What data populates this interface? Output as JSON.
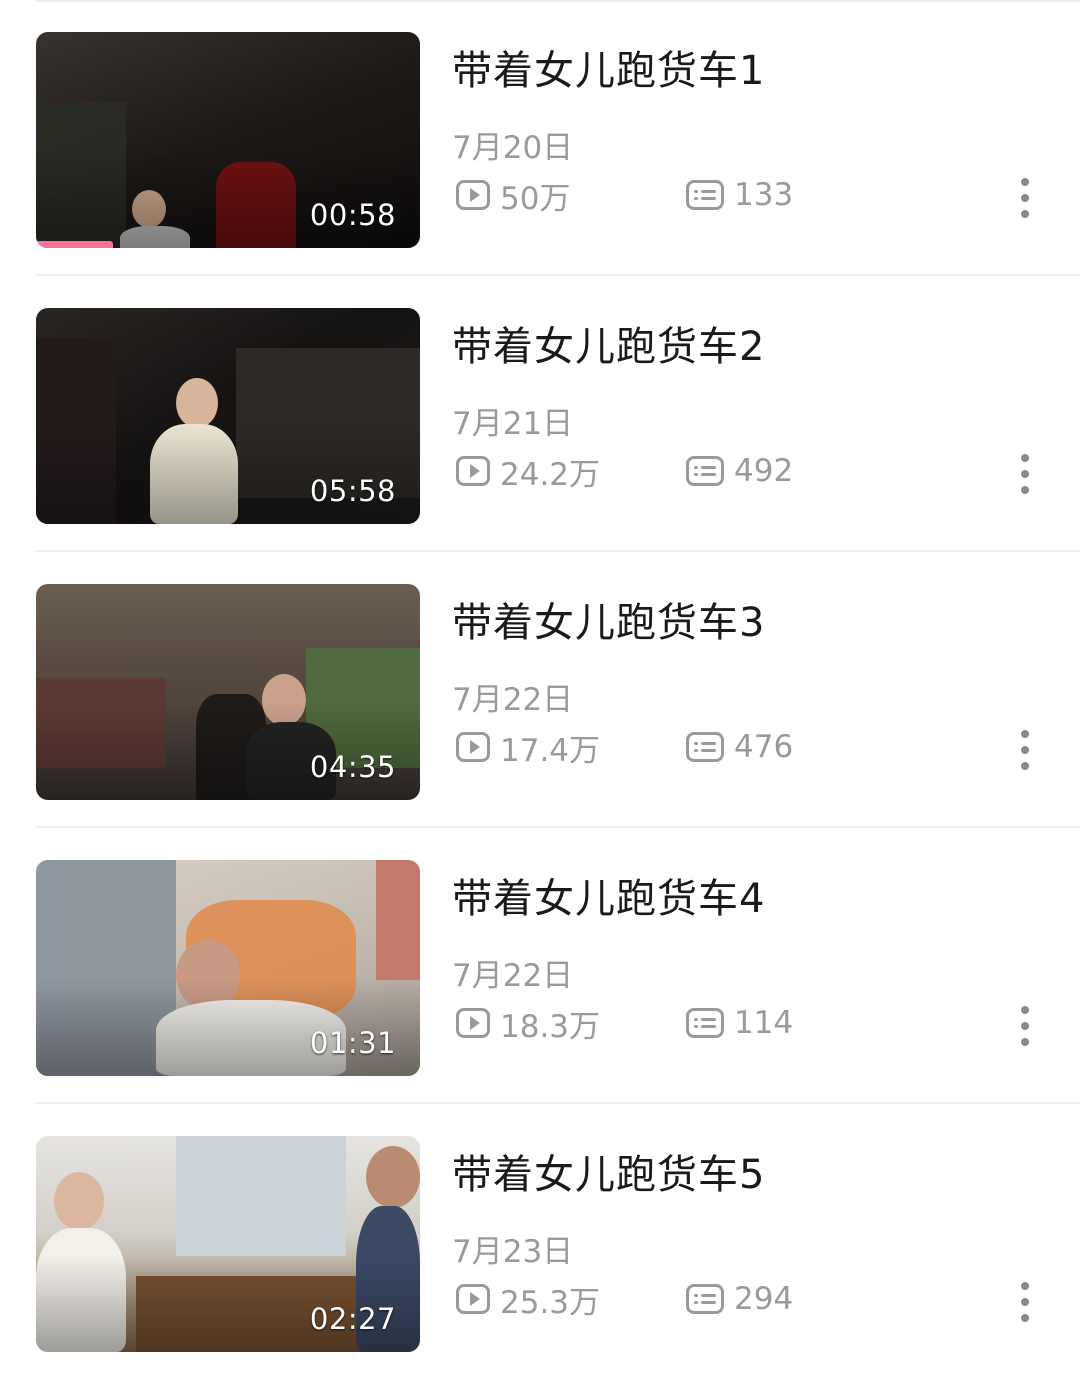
{
  "videos": [
    {
      "title": "带着女儿跑货车1",
      "date": "7月20日",
      "views": "50万",
      "danmaku": "133",
      "duration": "00:58",
      "watched_fraction": 0.2
    },
    {
      "title": "带着女儿跑货车2",
      "date": "7月21日",
      "views": "24.2万",
      "danmaku": "492",
      "duration": "05:58"
    },
    {
      "title": "带着女儿跑货车3",
      "date": "7月22日",
      "views": "17.4万",
      "danmaku": "476",
      "duration": "04:35"
    },
    {
      "title": "带着女儿跑货车4",
      "date": "7月22日",
      "views": "18.3万",
      "danmaku": "114",
      "duration": "01:31"
    },
    {
      "title": "带着女儿跑货车5",
      "date": "7月23日",
      "views": "25.3万",
      "danmaku": "294",
      "duration": "02:27"
    }
  ],
  "icons": {
    "views": "play-count-icon",
    "danmaku": "danmaku-count-icon",
    "more": "more-vertical-icon"
  },
  "accent": "#fb7299"
}
